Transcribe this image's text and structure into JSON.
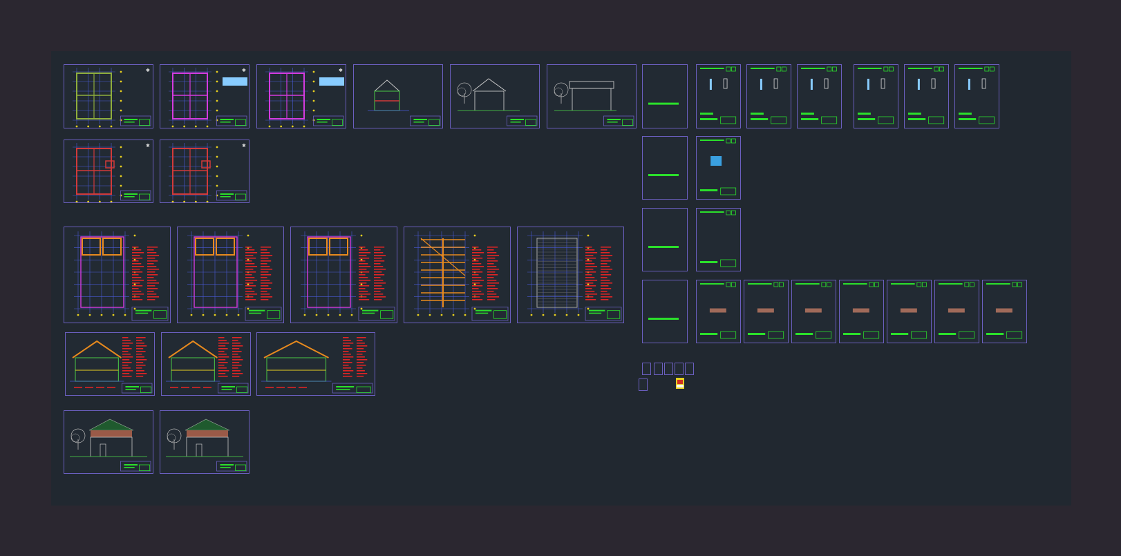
{
  "app": {
    "window_title": "",
    "view": "layout-sheets-overview"
  },
  "colors": {
    "background": "#2b2730",
    "canvas": "#212830",
    "sheet_border": "#6b5fc0",
    "grid": "#4a5bd8",
    "wall": "#d23a3a",
    "magenta": "#d43be0",
    "roof": "#e88a1e",
    "green": "#2be02b",
    "label": "#88ccff"
  },
  "sheets": [
    {
      "id": "s1",
      "kind": "plan"
    },
    {
      "id": "s2",
      "kind": "plan-notes"
    },
    {
      "id": "s3",
      "kind": "plan-notes"
    },
    {
      "id": "s4",
      "kind": "section-small"
    },
    {
      "id": "s5",
      "kind": "elevation-tree"
    },
    {
      "id": "s6",
      "kind": "elevation-tree-wide"
    },
    {
      "id": "s7",
      "kind": "blank-bar"
    },
    {
      "id": "s8",
      "kind": "detail"
    },
    {
      "id": "s9",
      "kind": "detail"
    },
    {
      "id": "s10",
      "kind": "detail"
    },
    {
      "id": "s11",
      "kind": "detail"
    },
    {
      "id": "s12",
      "kind": "detail"
    },
    {
      "id": "s13",
      "kind": "detail"
    },
    {
      "id": "s14",
      "kind": "plan-red"
    },
    {
      "id": "s15",
      "kind": "plan-red"
    },
    {
      "id": "s16",
      "kind": "blank-bar"
    },
    {
      "id": "s17",
      "kind": "detail-blue"
    },
    {
      "id": "s18",
      "kind": "structural-plan"
    },
    {
      "id": "s19",
      "kind": "structural-plan"
    },
    {
      "id": "s20",
      "kind": "structural-plan"
    },
    {
      "id": "s21",
      "kind": "roof-framing"
    },
    {
      "id": "s22",
      "kind": "roof-plan"
    },
    {
      "id": "s23",
      "kind": "blank-bar"
    },
    {
      "id": "s24",
      "kind": "detail-empty"
    },
    {
      "id": "s25",
      "kind": "blank-bar"
    },
    {
      "id": "s26",
      "kind": "detail-object"
    },
    {
      "id": "s27",
      "kind": "detail-object"
    },
    {
      "id": "s28",
      "kind": "detail-object"
    },
    {
      "id": "s29",
      "kind": "detail-object"
    },
    {
      "id": "s30",
      "kind": "detail-object"
    },
    {
      "id": "s31",
      "kind": "detail-object"
    },
    {
      "id": "s32",
      "kind": "detail-object"
    },
    {
      "id": "s33",
      "kind": "section-large"
    },
    {
      "id": "s34",
      "kind": "section-large"
    },
    {
      "id": "s35",
      "kind": "section-large"
    },
    {
      "id": "s36",
      "kind": "elevation-color"
    },
    {
      "id": "s37",
      "kind": "elevation-color"
    }
  ]
}
